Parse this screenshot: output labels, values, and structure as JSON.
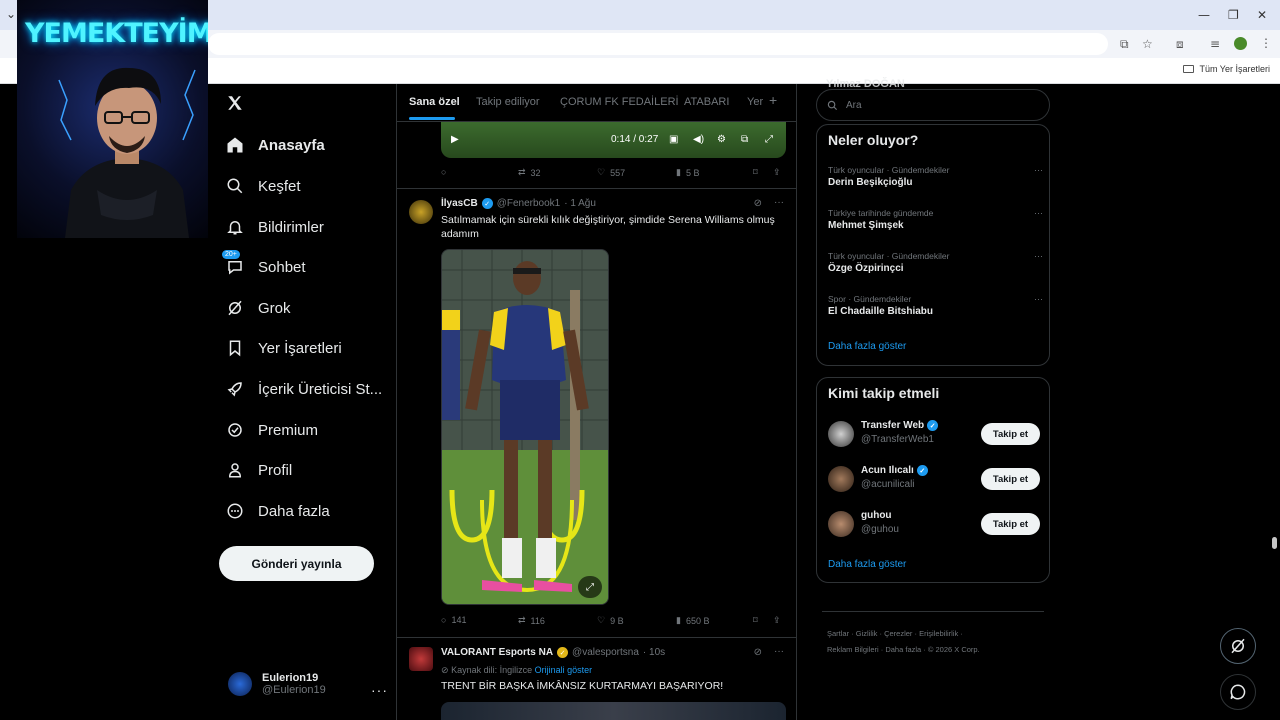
{
  "browser": {
    "bookmarks_label": "Tüm Yer İşaretleri",
    "window_controls": [
      "—",
      "❐",
      "✕"
    ]
  },
  "overlay": {
    "title": "YEMEKTEYİM"
  },
  "nav": {
    "items": [
      {
        "label": "Anasayfa",
        "icon": "home-icon"
      },
      {
        "label": "Keşfet",
        "icon": "search-icon"
      },
      {
        "label": "Bildirimler",
        "icon": "bell-icon"
      },
      {
        "label": "Sohbet",
        "icon": "chat-icon",
        "badge": "20+"
      },
      {
        "label": "Grok",
        "icon": "grok-icon"
      },
      {
        "label": "Yer İşaretleri",
        "icon": "bookmark-icon"
      },
      {
        "label": "İçerik Üreticisi St...",
        "icon": "rocket-icon"
      },
      {
        "label": "Premium",
        "icon": "verified-icon"
      },
      {
        "label": "Profil",
        "icon": "person-icon"
      },
      {
        "label": "Daha fazla",
        "icon": "more-circle-icon"
      }
    ],
    "post_button": "Gönderi yayınla",
    "account": {
      "name": "Eulerion19",
      "handle": "@Eulerion19"
    }
  },
  "tabs": [
    "Sana özel",
    "Takip ediliyor",
    "ÇORUM FK FEDAİLERİ",
    "ATABARI",
    "Yer"
  ],
  "video": {
    "time": "0:14 / 0:27"
  },
  "prev_post_actions": {
    "replies": "",
    "reposts": "32",
    "likes": "557",
    "views": "5 B"
  },
  "post": {
    "name": "İlyasCB",
    "handle": "@Fenerbook1",
    "time": "· 1 Ağu",
    "text": "Satılmamak için sürekli kılık değiştiriyor, şimdide Serena Williams olmuş adamım",
    "actions": {
      "replies": "141",
      "reposts": "116",
      "likes": "9 B",
      "views": "650 B"
    }
  },
  "post2": {
    "name": "VALORANT Esports NA",
    "handle": "@valesportsna",
    "time": "· 10s",
    "translate_prefix": "Kaynak dili: İngilizce",
    "translate_link": "Orijinali göster",
    "text": "TRENT BİR BAŞKA İMKÂNSIZ KURTARMAYI BAŞARIYOR!"
  },
  "right": {
    "partial_top": "Yılmaz DOĞAN",
    "search_placeholder": "Ara",
    "trends_title": "Neler oluyor?",
    "trends": [
      {
        "context": "Türk oyuncular · Gündemdekiler",
        "name": "Derin Beşikçioğlu"
      },
      {
        "context": "Türkiye tarihinde gündemde",
        "name": "Mehmet Şimşek"
      },
      {
        "context": "Türk oyuncular · Gündemdekiler",
        "name": "Özge Özpirinçci"
      },
      {
        "context": "Spor · Gündemdekiler",
        "name": "El Chadaille Bitshiabu"
      }
    ],
    "trends_more": "Daha fazla göster",
    "who_title": "Kimi takip etmeli",
    "who": [
      {
        "name": "Transfer Web",
        "handle": "@TransferWeb1",
        "verified": true,
        "button": "Takip et"
      },
      {
        "name": "Acun Ilıcalı",
        "handle": "@acunilicali",
        "verified": true,
        "button": "Takip et"
      },
      {
        "name": "guhou",
        "handle": "@guhou",
        "verified": false,
        "button": "Takip et"
      }
    ],
    "who_more": "Daha fazla göster",
    "footer_line1": "Şartlar · Gizlilik · Çerezler · Erişilebilirlik ·",
    "footer_line2": "Reklam Bilgileri · Daha fazla · © 2026 X Corp."
  },
  "colors": {
    "accent": "#1d9bf0",
    "background": "#000000",
    "text": "#e7e9ea",
    "muted": "#71767b"
  }
}
